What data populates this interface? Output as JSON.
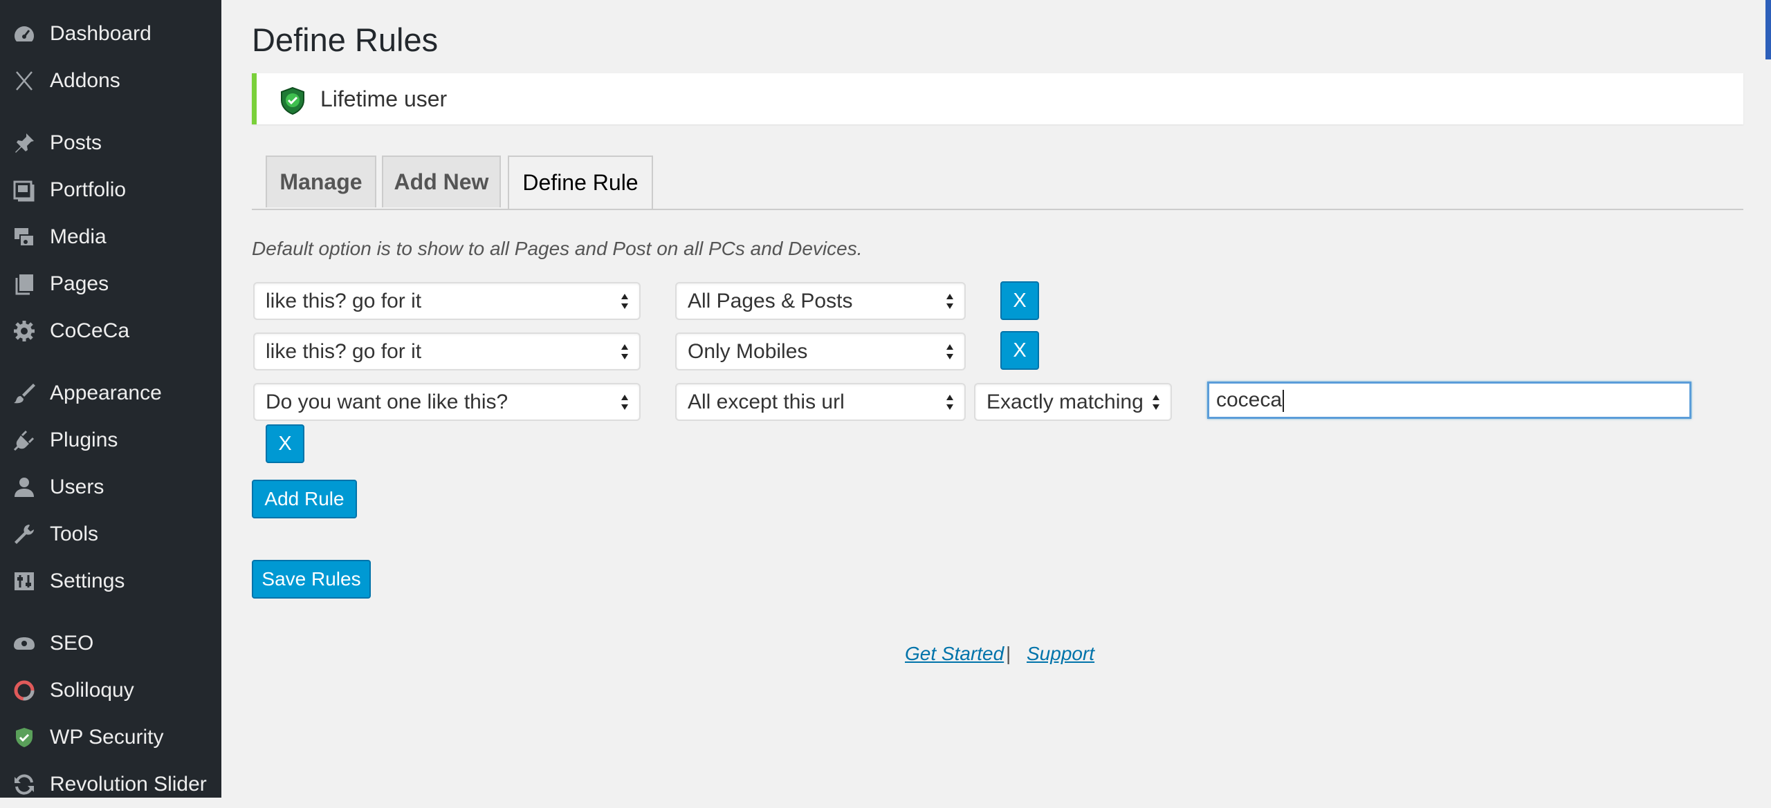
{
  "sidebar": {
    "items": [
      {
        "label": "Dashboard",
        "icon": "dashboard-icon"
      },
      {
        "label": "Addons",
        "icon": "addons-icon"
      },
      {
        "label": "Posts",
        "icon": "pushpin-icon"
      },
      {
        "label": "Portfolio",
        "icon": "portfolio-icon"
      },
      {
        "label": "Media",
        "icon": "media-icon"
      },
      {
        "label": "Pages",
        "icon": "pages-icon"
      },
      {
        "label": "CoCeCa",
        "icon": "gear-icon"
      },
      {
        "label": "Appearance",
        "icon": "paintbrush-icon"
      },
      {
        "label": "Plugins",
        "icon": "plugin-icon"
      },
      {
        "label": "Users",
        "icon": "user-icon"
      },
      {
        "label": "Tools",
        "icon": "wrench-icon"
      },
      {
        "label": "Settings",
        "icon": "settings-sliders-icon"
      },
      {
        "label": "SEO",
        "icon": "seo-icon"
      },
      {
        "label": "Soliloquy",
        "icon": "soliloquy-icon"
      },
      {
        "label": "WP Security",
        "icon": "shield-icon"
      },
      {
        "label": "Revolution Slider",
        "icon": "refresh-icon"
      }
    ]
  },
  "main": {
    "title": "Define Rules",
    "notice": "Lifetime user",
    "tabs": [
      {
        "label": "Manage"
      },
      {
        "label": "Add New"
      },
      {
        "label": "Define Rule",
        "active": true
      }
    ],
    "hint": "Default option is to show to all Pages and Post on all PCs and Devices.",
    "rules": [
      {
        "action": "like this? go for it",
        "target": "All Pages & Posts",
        "remove_label": "X"
      },
      {
        "action": "like this? go for it",
        "target": "Only Mobiles",
        "remove_label": "X"
      },
      {
        "action": "Do you want one like this?",
        "target": "All except this url",
        "match": "Exactly matching",
        "url_value": "coceca",
        "remove_label": "X"
      }
    ],
    "add_rule_label": "Add Rule",
    "save_rules_label": "Save Rules",
    "footer": {
      "get_started": "Get Started",
      "separator": "|",
      "support": "Support"
    }
  },
  "colors": {
    "sidebar_bg": "#23282d",
    "button_blue": "#0099d3",
    "notice_green": "#7ad03a",
    "link_blue": "#0073aa"
  }
}
